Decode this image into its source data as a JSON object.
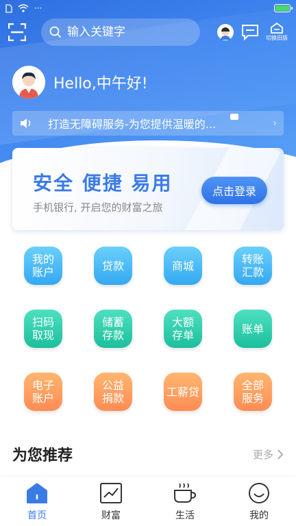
{
  "status_bar": {
    "dots": "···"
  },
  "top_bar": {
    "search_placeholder": "输入关键字",
    "switch_label": "切换旧版"
  },
  "greeting": {
    "text": "Hello,中午好!"
  },
  "notice": {
    "text": "打造无障碍服务-为您提供温暖的..."
  },
  "login_card": {
    "headline": "安全 便捷 易用",
    "subtitle": "手机银行, 开启您的财富之旅",
    "login_button": "点击登录"
  },
  "services": [
    [
      {
        "label": "我的账户",
        "color": "#34a8f2"
      },
      {
        "label": "贷款",
        "color": "#34a8f2"
      },
      {
        "label": "商城",
        "color": "#34a8f2"
      },
      {
        "label": "转账汇款",
        "color": "#34a8f2"
      }
    ],
    [
      {
        "label": "扫码取现",
        "color": "#1cbf9c"
      },
      {
        "label": "储蓄存款",
        "color": "#1cbf9c"
      },
      {
        "label": "大额存单",
        "color": "#1cbf9c"
      },
      {
        "label": "账单",
        "color": "#1cbf9c"
      }
    ],
    [
      {
        "label": "电子账户",
        "color": "#ff8c54"
      },
      {
        "label": "公益捐款",
        "color": "#ff8c54"
      },
      {
        "label": "工薪贷",
        "color": "#ff8c54"
      },
      {
        "label": "全部服务",
        "color": "#ff8c54"
      }
    ]
  ],
  "recommend": {
    "title": "为您推荐",
    "more": "更多"
  },
  "bottom_nav": [
    {
      "label": "首页",
      "icon": "home-icon",
      "active": true
    },
    {
      "label": "财富",
      "icon": "chart-icon",
      "active": false
    },
    {
      "label": "生活",
      "icon": "coffee-icon",
      "active": false
    },
    {
      "label": "我的",
      "icon": "smile-icon",
      "active": false
    }
  ],
  "colors": {
    "brand": "#3b7be8",
    "accent_blue": "#34a8f2",
    "accent_green": "#1cbf9c",
    "accent_orange": "#ff8c54"
  }
}
